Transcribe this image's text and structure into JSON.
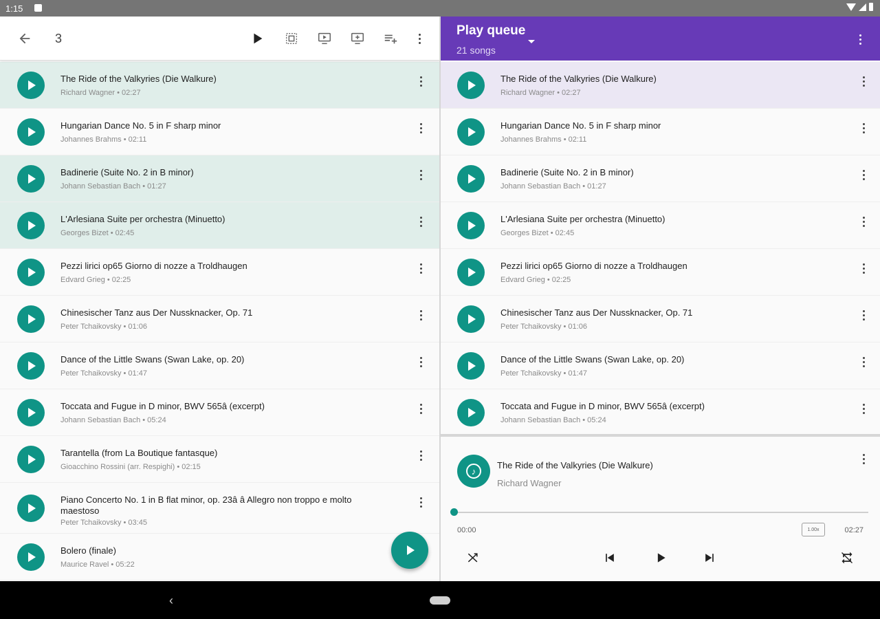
{
  "status_bar": {
    "time": "1:15"
  },
  "library": {
    "title": "3",
    "songs": [
      {
        "title": "The Ride of the Valkyries (Die Walkure)",
        "meta": "Richard Wagner • 02:27"
      },
      {
        "title": "Hungarian Dance No. 5 in F sharp minor",
        "meta": "Johannes Brahms • 02:11"
      },
      {
        "title": "Badinerie (Suite No. 2 in B minor)",
        "meta": "Johann Sebastian Bach • 01:27"
      },
      {
        "title": "L'Arlesiana Suite per orchestra (Minuetto)",
        "meta": "Georges Bizet • 02:45"
      },
      {
        "title": "Pezzi lirici op65 Giorno di nozze a Troldhaugen",
        "meta": "Edvard Grieg • 02:25"
      },
      {
        "title": "Chinesischer Tanz aus Der Nussknacker, Op. 71",
        "meta": "Peter Tchaikovsky • 01:06"
      },
      {
        "title": "Dance of the Little Swans (Swan Lake, op. 20)",
        "meta": "Peter Tchaikovsky • 01:47"
      },
      {
        "title": "Toccata and Fugue in D minor, BWV 565â (excerpt)",
        "meta": "Johann Sebastian Bach • 05:24"
      },
      {
        "title": "Tarantella (from La Boutique fantasque)",
        "meta": "Gioacchino Rossini (arr. Respighi) • 02:15"
      },
      {
        "title": "Piano Concerto No. 1 in B flat minor, op. 23â  â Allegro non troppo e molto maestoso",
        "meta": "Peter Tchaikovsky • 03:45"
      },
      {
        "title": "Bolero (finale)",
        "meta": "Maurice Ravel • 05:22"
      }
    ]
  },
  "queue": {
    "title": "Play queue",
    "subtitle": "21 songs",
    "songs": [
      {
        "title": "The Ride of the Valkyries (Die Walkure)",
        "meta": "Richard Wagner • 02:27"
      },
      {
        "title": "Hungarian Dance No. 5 in F sharp minor",
        "meta": "Johannes Brahms • 02:11"
      },
      {
        "title": "Badinerie (Suite No. 2 in B minor)",
        "meta": "Johann Sebastian Bach • 01:27"
      },
      {
        "title": "L'Arlesiana Suite per orchestra (Minuetto)",
        "meta": "Georges Bizet • 02:45"
      },
      {
        "title": "Pezzi lirici op65 Giorno di nozze a Troldhaugen",
        "meta": "Edvard Grieg • 02:25"
      },
      {
        "title": "Chinesischer Tanz aus Der Nussknacker, Op. 71",
        "meta": "Peter Tchaikovsky • 01:06"
      },
      {
        "title": "Dance of the Little Swans (Swan Lake, op. 20)",
        "meta": "Peter Tchaikovsky • 01:47"
      },
      {
        "title": "Toccata and Fugue in D minor, BWV 565â (excerpt)",
        "meta": "Johann Sebastian Bach • 05:24"
      }
    ]
  },
  "now_playing": {
    "title": "The Ride of the Valkyries (Die Walkure)",
    "artist": "Richard Wagner",
    "current_time": "00:00",
    "total_time": "02:27",
    "speed": "1.00x",
    "progress": 0
  },
  "colors": {
    "accent": "#0f9486",
    "queue_header": "#673ab7",
    "selected_library": "#e0eeea",
    "selected_queue": "#ebe7f4"
  }
}
